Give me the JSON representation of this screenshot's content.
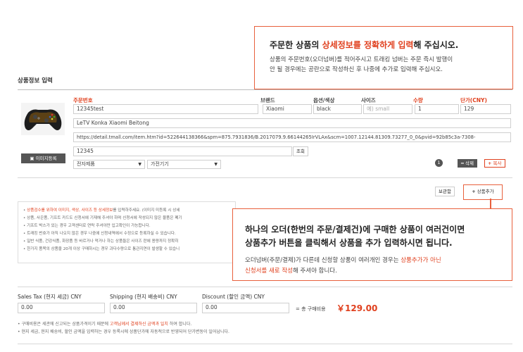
{
  "section": {
    "title": "상품정보 입력"
  },
  "callout_top": {
    "title_pre": "주문한 상품의 ",
    "title_hl": "상세정보를 정확하게 입력",
    "title_post": "해 주십시오.",
    "line1": "상품의 주문번호(오더넘버)를 적어주시고 트래킹 넘버는 주문 즉시 발행이",
    "line2": "안 될 경우에는 공란으로 작성하신 후 나중에 추가로 입력해 주십시오."
  },
  "columns": {
    "order_no": "주문번호",
    "brand": "브랜드",
    "option": "옵션/색상",
    "size": "사이즈",
    "qty": "수량",
    "price": "단가(CNY)"
  },
  "item": {
    "order_no": "12345test",
    "brand": "Xiaomi",
    "option": "black",
    "size_placeholder": "예) small",
    "qty": "1",
    "price": "129",
    "name": "LeTV Konka Xiaomi  Beitong",
    "url": "https://detail.tmall.com/item.htm?id=522644138366&spm=875.7931836/B.2017079.9.66144265IrVLAx&scm=1007.12144.81309.73277_0_0&pvid=92b85c3a-7308-",
    "tracking": "12345",
    "category1": "전자제품",
    "category2": "가전기기"
  },
  "buttons": {
    "image_register": "이미지등록",
    "lookup": "조회",
    "delete": "삭제",
    "copy": "복사",
    "save": "보관함",
    "add_item": "상품추가"
  },
  "badge_count": "1",
  "notices": [
    {
      "red": "상품검수를 위하여 이미지, 색상, 사이즈 등 상세정보",
      "text": "를 입력하주세요. (이미지 미등록 시 상세"
    },
    {
      "red": "",
      "text": "상품, 사은품, 기프트 카드도 신청서에 기재해 주셔야 하며 신청서에 작성되지 않은 물품은 폐기"
    },
    {
      "red": "",
      "text": "기프트 박스가 있는 경우 고객센터로 연락 주셔야만 입고확인이 가능합니다."
    },
    {
      "red": "",
      "text": "트래킹 번호가 아직 나오지 않은 경우 나중에 신청내역에서 수정으로 등록하실 수 있습니다."
    },
    {
      "red": "",
      "text": "일반 식품, 건강식품, 화장품 등 바르거나 먹거나 하는 상품들은 사이즈 란에 용량까지 정확히"
    },
    {
      "red": "",
      "text": "한가지 품목의 상품을 20개 이상 구매하시는 경우 과다수량으로 통관지연이 발생할 수 있습니"
    }
  ],
  "callout_bottom": {
    "line1": "하나의 오더(한번의 주문/결제건)에 구매한 상품이 여러건이면",
    "line2": "상품추가 버튼을 클릭해서 상품을 추가 입력하시면 됩니다.",
    "body1": "오더넘버(주문/결제)가 다른데 신청할 상품이 여러개인 경우는 ",
    "body1_hl": "상품추가가 아닌",
    "body2_hl": "신청서를 새로 작성",
    "body2": "해 주셔야 합니다."
  },
  "totals": {
    "sales_tax_label": "Sales Tax (현지 세금) CNY",
    "shipping_label": "Shipping (현지 배송비) CNY",
    "discount_label": "Discount (할인 금액) CNY",
    "sales_tax": "0.00",
    "shipping": "0.00",
    "discount": "0.00",
    "total_label": "= 총 구매비용",
    "total_value": "￥129.00"
  },
  "footnotes": {
    "line1_pre": "구매비용은 세관에 신고되는 상품가격이기 때문에 ",
    "line1_hl": "고객님께서 결제하신 금액과 일치",
    "line1_post": " 하여 합니다.",
    "line2": "현지 세금, 현지 배송비, 할인 금액을 입력하는 경우 등록시에 상품단가에 자동적으로 반영되어 단가변동이 일어납니다."
  },
  "icons": {
    "camera": "camera-icon",
    "plus": "plus-icon",
    "minus": "minus-icon",
    "select_arrow": "chevron-down-icon"
  }
}
